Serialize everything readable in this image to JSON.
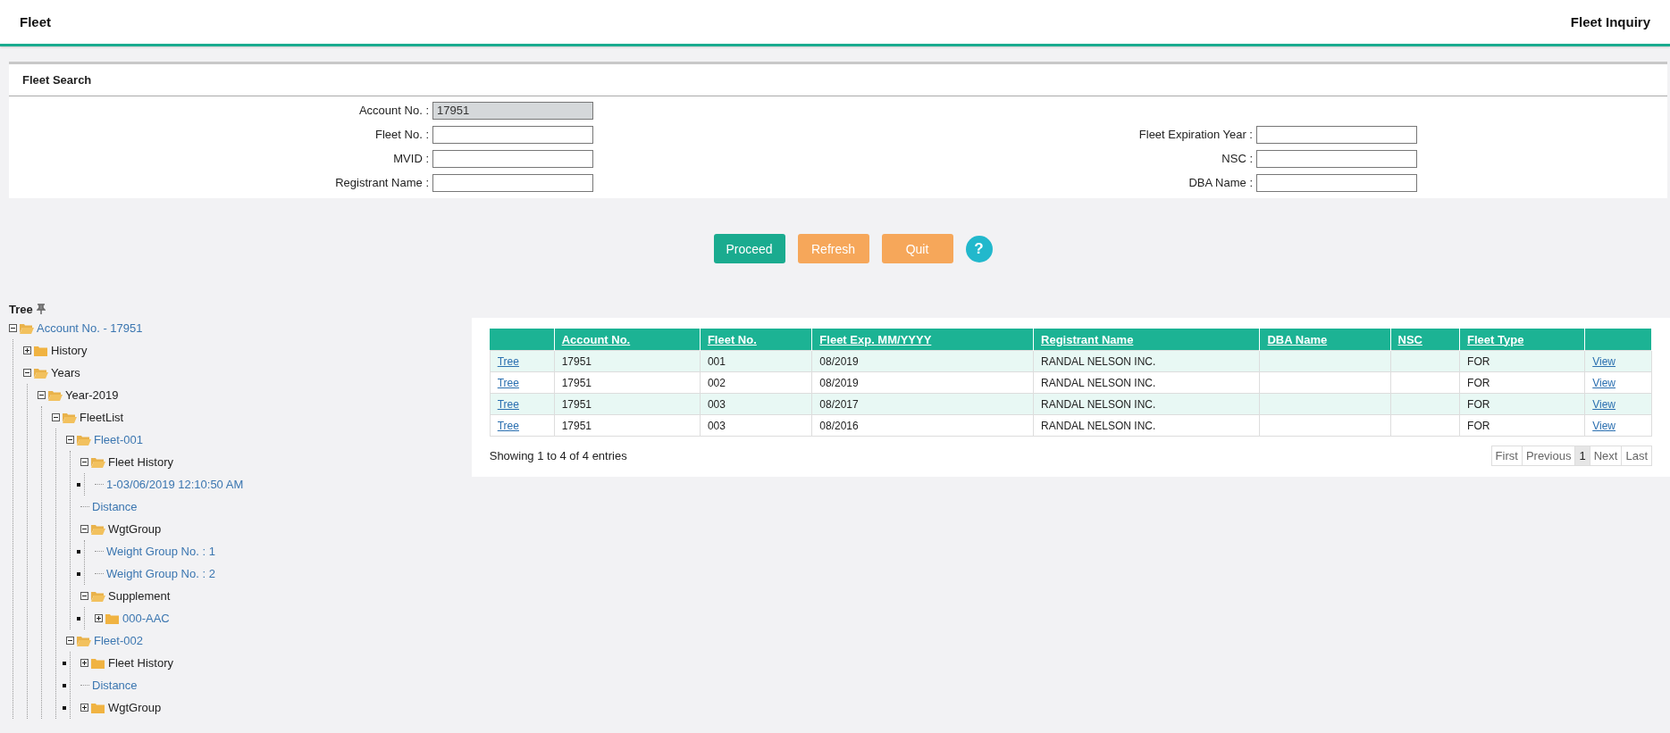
{
  "header": {
    "title": "Fleet",
    "page_title": "Fleet Inquiry"
  },
  "search": {
    "title": "Fleet Search",
    "left_fields": [
      {
        "label": "Account No. :",
        "value": "17951",
        "disabled": true
      },
      {
        "label": "Fleet No. :",
        "disabled": false
      },
      {
        "label": "MVID :",
        "disabled": false
      },
      {
        "label": "Registrant Name :",
        "disabled": false
      }
    ],
    "right_fields": [
      {
        "label": "Fleet Expiration Year :",
        "disabled": false
      },
      {
        "label": "NSC :",
        "disabled": false
      },
      {
        "label": "DBA Name :",
        "disabled": false
      }
    ]
  },
  "buttons": [
    {
      "label": "Proceed",
      "kind": "primary"
    },
    {
      "label": "Refresh",
      "kind": "warning"
    },
    {
      "label": "Quit",
      "kind": "warning"
    },
    {
      "label": "?",
      "kind": "help"
    }
  ],
  "tree": {
    "title": "Tree",
    "nodes": [
      {
        "label": "Account No. - 17951",
        "kind": "folder",
        "link": true,
        "expanded": true,
        "children": [
          {
            "label": "History",
            "kind": "folder",
            "link": false,
            "expanded": false
          },
          {
            "label": "Years",
            "kind": "folder",
            "link": false,
            "expanded": true,
            "children": [
              {
                "label": "Year-2019",
                "kind": "folder",
                "link": false,
                "expanded": true,
                "children": [
                  {
                    "label": "FleetList",
                    "kind": "folder",
                    "link": false,
                    "expanded": true,
                    "children": [
                      {
                        "label": "Fleet-001",
                        "kind": "folder",
                        "link": true,
                        "expanded": true,
                        "children": [
                          {
                            "label": "Fleet History",
                            "kind": "folder",
                            "link": false,
                            "expanded": true,
                            "children": [
                              {
                                "label": "1-03/06/2019 12:10:50 AM",
                                "kind": "leaf",
                                "link": true,
                                "marker": true
                              }
                            ]
                          },
                          {
                            "label": "Distance",
                            "kind": "leaf",
                            "link": true
                          },
                          {
                            "label": "WgtGroup",
                            "kind": "folder",
                            "link": false,
                            "expanded": true,
                            "children": [
                              {
                                "label": "Weight Group No. : 1",
                                "kind": "leaf",
                                "link": true,
                                "marker": true
                              },
                              {
                                "label": "Weight Group No. : 2",
                                "kind": "leaf",
                                "link": true,
                                "marker": true
                              }
                            ]
                          },
                          {
                            "label": "Supplement",
                            "kind": "folder",
                            "link": false,
                            "expanded": true,
                            "children": [
                              {
                                "label": "000-AAC",
                                "kind": "folder",
                                "link": true,
                                "expanded": false,
                                "marker": true
                              }
                            ]
                          }
                        ]
                      },
                      {
                        "label": "Fleet-002",
                        "kind": "folder",
                        "link": true,
                        "expanded": true,
                        "children": [
                          {
                            "label": "Fleet History",
                            "kind": "folder",
                            "link": false,
                            "expanded": false,
                            "marker": true
                          },
                          {
                            "label": "Distance",
                            "kind": "leaf",
                            "link": true,
                            "marker": true
                          },
                          {
                            "label": "WgtGroup",
                            "kind": "folder",
                            "link": false,
                            "expanded": false,
                            "marker": true
                          }
                        ]
                      }
                    ]
                  }
                ]
              }
            ]
          }
        ]
      }
    ]
  },
  "table": {
    "columns": [
      "",
      "Account No.",
      "Fleet No.",
      "Fleet Exp. MM/YYYY",
      "Registrant Name",
      "DBA Name",
      "NSC",
      "Fleet Type",
      ""
    ],
    "rows": [
      [
        "Tree",
        "17951",
        "001",
        "08/2019",
        "RANDAL NELSON INC.",
        "",
        "",
        "FOR",
        "View"
      ],
      [
        "Tree",
        "17951",
        "002",
        "08/2019",
        "RANDAL NELSON INC.",
        "",
        "",
        "FOR",
        "View"
      ],
      [
        "Tree",
        "17951",
        "003",
        "08/2017",
        "RANDAL NELSON INC.",
        "",
        "",
        "FOR",
        "View"
      ],
      [
        "Tree",
        "17951",
        "003",
        "08/2016",
        "RANDAL NELSON INC.",
        "",
        "",
        "FOR",
        "View"
      ]
    ],
    "info": "Showing 1 to 4 of 4 entries",
    "pagination": [
      {
        "label": "First",
        "selected": false
      },
      {
        "label": "Previous",
        "selected": false
      },
      {
        "label": "1",
        "selected": true
      },
      {
        "label": "Next",
        "selected": false
      },
      {
        "label": "Last",
        "selected": false
      }
    ]
  }
}
